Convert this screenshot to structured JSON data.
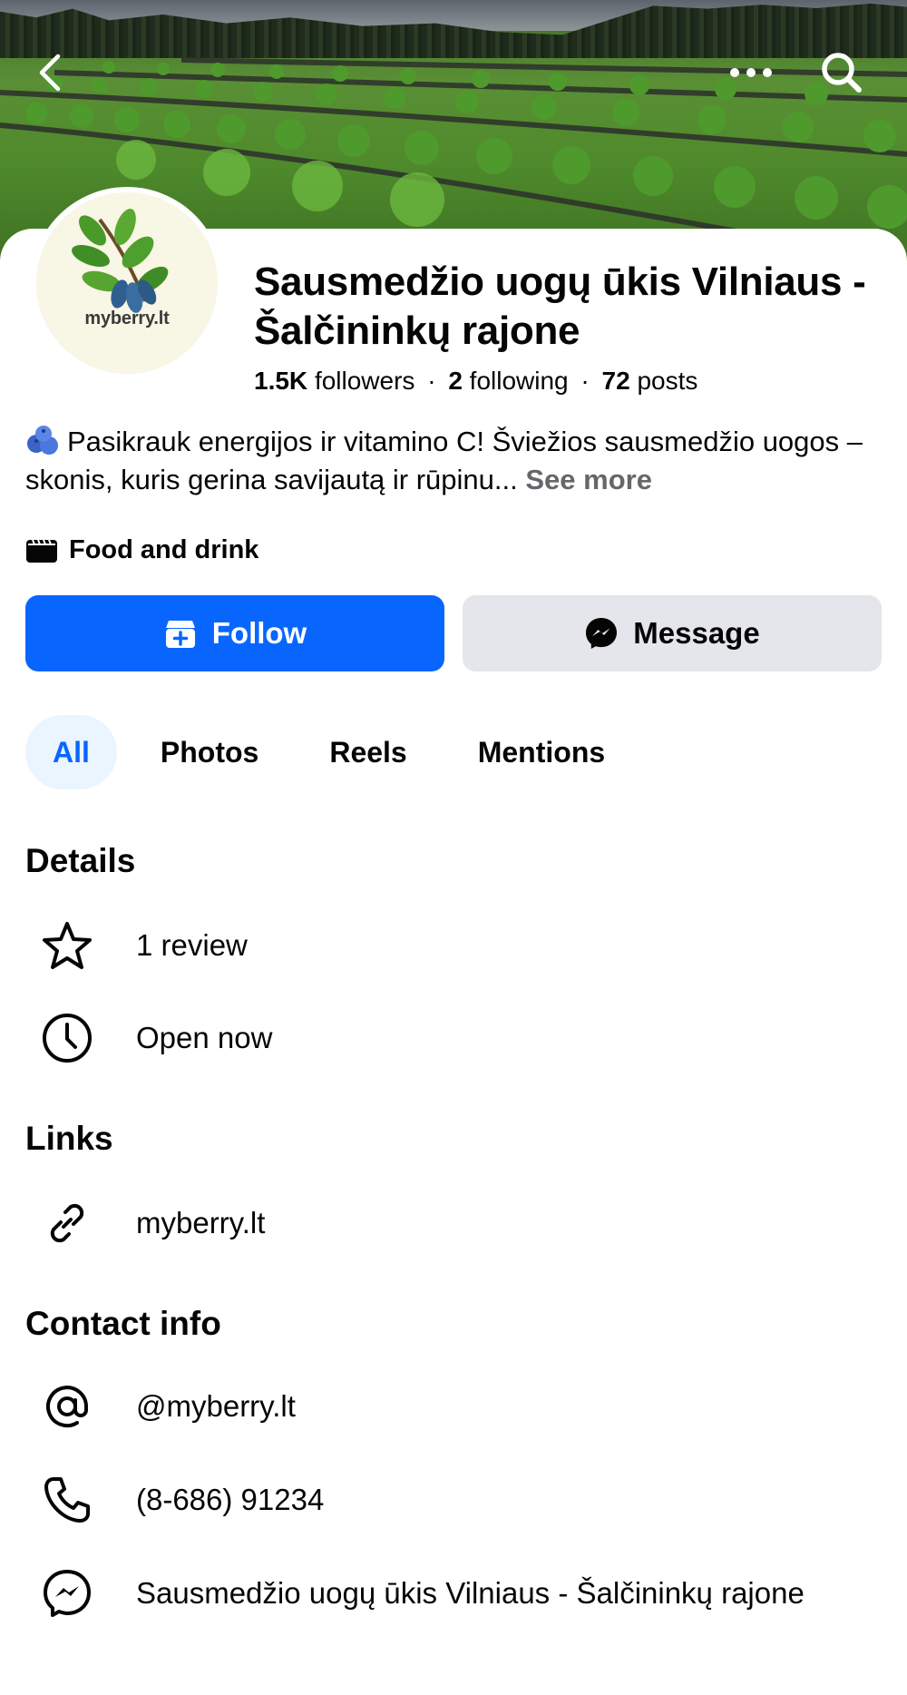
{
  "page": {
    "name": "Sausmedžio uogų ūkis Vilniaus - Šalčininkų rajone",
    "stats": {
      "followers_count": "1.5K",
      "followers_label": "followers",
      "following_count": "2",
      "following_label": "following",
      "posts_count": "72",
      "posts_label": "posts",
      "separator": "·"
    },
    "avatar": {
      "logo_text": "myberry.lt"
    },
    "bio": {
      "text": "Pasikrauk energijos ir vitamino C! Šviežios sausmedžio uogos – skonis, kuris gerina savijautą ir rūpinu...",
      "see_more": "See more"
    },
    "category": {
      "label": "Food and drink",
      "icon": "store-icon"
    }
  },
  "actions": {
    "follow_label": "Follow",
    "message_label": "Message"
  },
  "tabs": [
    {
      "label": "All",
      "active": true
    },
    {
      "label": "Photos",
      "active": false
    },
    {
      "label": "Reels",
      "active": false
    },
    {
      "label": "Mentions",
      "active": false
    }
  ],
  "details": {
    "title": "Details",
    "items": [
      {
        "icon": "star-icon",
        "text": "1 review"
      },
      {
        "icon": "clock-icon",
        "text": "Open now"
      }
    ]
  },
  "links": {
    "title": "Links",
    "items": [
      {
        "icon": "link-icon",
        "text": "myberry.lt"
      }
    ]
  },
  "contact": {
    "title": "Contact info",
    "items": [
      {
        "icon": "at-icon",
        "text": "@myberry.lt"
      },
      {
        "icon": "phone-icon",
        "text": "(8-686) 91234"
      },
      {
        "icon": "messenger-icon",
        "text": "Sausmedžio uogų ūkis Vilniaus - Šalčininkų rajone"
      }
    ]
  },
  "colors": {
    "accent": "#0866ff",
    "tab_active_bg": "#ebf5ff",
    "secondary_button_bg": "#e4e6eb",
    "muted_text": "#65676b"
  }
}
